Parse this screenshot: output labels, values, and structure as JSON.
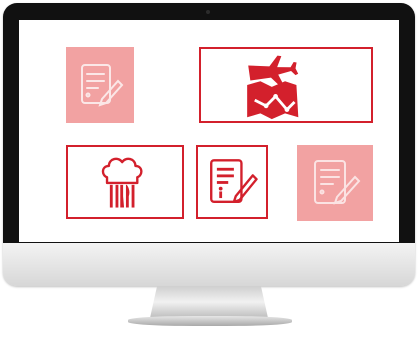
{
  "monitor": {
    "kind": "desktop-monitor",
    "screen_background": "#ffffff"
  },
  "tiles": [
    {
      "name": "document-edit-tile",
      "state": "faded",
      "icon": "document-edit-icon"
    },
    {
      "name": "travel-tile",
      "state": "highlighted",
      "icon": "airplane-map-chart-icon"
    },
    {
      "name": "restaurant-tile",
      "state": "highlighted",
      "icon": "chef-hat-cutlery-icon"
    },
    {
      "name": "info-form-tile",
      "state": "highlighted",
      "icon": "document-info-edit-icon"
    },
    {
      "name": "document-edit-tile-2",
      "state": "faded",
      "icon": "document-edit-icon"
    }
  ],
  "colors": {
    "accent": "#d3202c",
    "faded_tile": "#f2a2a2",
    "bezel": "#111111"
  }
}
